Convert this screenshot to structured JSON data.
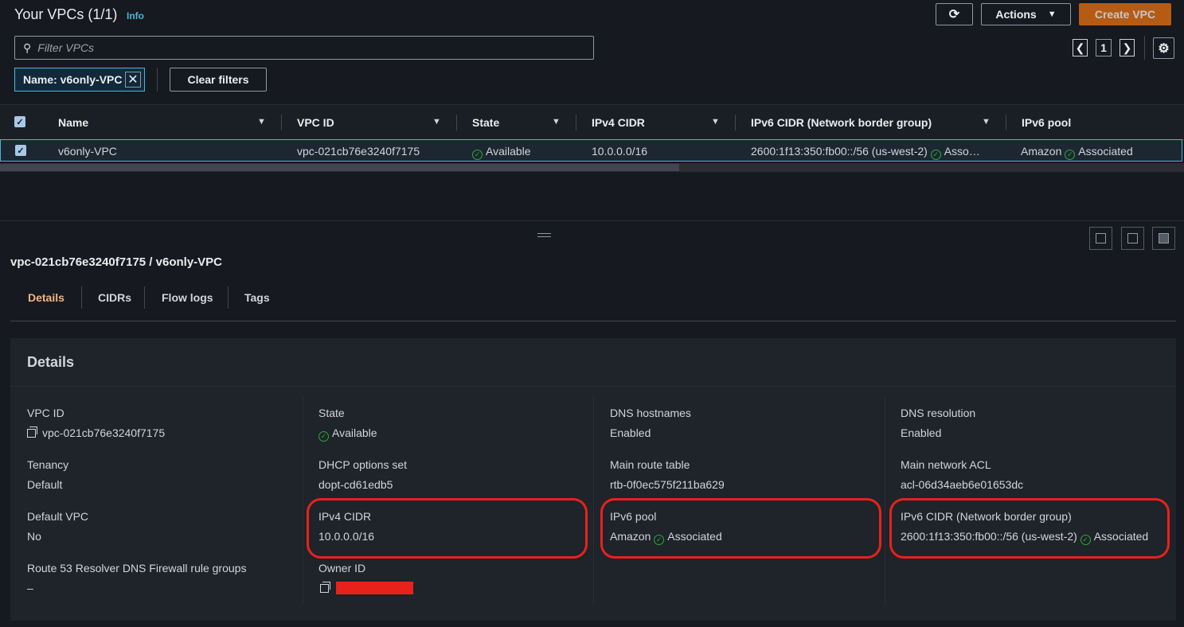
{
  "header": {
    "title": "Your VPCs (1/1)",
    "info": "Info"
  },
  "toolbar": {
    "actions": "Actions",
    "create": "Create VPC"
  },
  "search": {
    "placeholder": "Filter VPCs"
  },
  "filter_chip": {
    "label": "Name: v6only-VPC"
  },
  "clear_filters": "Clear filters",
  "pagination": {
    "page": "1"
  },
  "columns": [
    "Name",
    "VPC ID",
    "State",
    "IPv4 CIDR",
    "IPv6 CIDR (Network border group)",
    "IPv6 pool"
  ],
  "row": {
    "name": "v6only-VPC",
    "vpc_id": "vpc-021cb76e3240f7175",
    "state": "Available",
    "ipv4": "10.0.0.0/16",
    "ipv6_cidr": "2600:1f13:350:fb00::/56 (us-west-2)",
    "ipv6_cidr_status": "Asso…",
    "ipv6_pool": "Amazon",
    "ipv6_pool_status": "Associated"
  },
  "detail": {
    "title": "vpc-021cb76e3240f7175 / v6only-VPC",
    "tabs": [
      "Details",
      "CIDRs",
      "Flow logs",
      "Tags"
    ],
    "panel_title": "Details",
    "fields": {
      "vpc_id_label": "VPC ID",
      "vpc_id": "vpc-021cb76e3240f7175",
      "tenancy_label": "Tenancy",
      "tenancy": "Default",
      "default_vpc_label": "Default VPC",
      "default_vpc": "No",
      "r53_label": "Route 53 Resolver DNS Firewall rule groups",
      "r53": "–",
      "state_label": "State",
      "state": "Available",
      "dhcp_label": "DHCP options set",
      "dhcp": "dopt-cd61edb5",
      "ipv4_label": "IPv4 CIDR",
      "ipv4": "10.0.0.0/16",
      "owner_label": "Owner ID",
      "dns_hostnames_label": "DNS hostnames",
      "dns_hostnames": "Enabled",
      "main_rt_label": "Main route table",
      "main_rt": "rtb-0f0ec575f211ba629",
      "ipv6_pool_label": "IPv6 pool",
      "ipv6_pool": "Amazon",
      "ipv6_pool_status": "Associated",
      "dns_resolution_label": "DNS resolution",
      "dns_resolution": "Enabled",
      "main_acl_label": "Main network ACL",
      "main_acl": "acl-06d34aeb6e01653dc",
      "ipv6_cidr_label": "IPv6 CIDR (Network border group)",
      "ipv6_cidr": "2600:1f13:350:fb00::/56 (us-west-2)",
      "ipv6_cidr_status": "Associated"
    }
  },
  "colors": {
    "accent": "#ec7211",
    "selection": "#44b9d6",
    "success": "#29ad32",
    "highlight": "#e8221b"
  }
}
